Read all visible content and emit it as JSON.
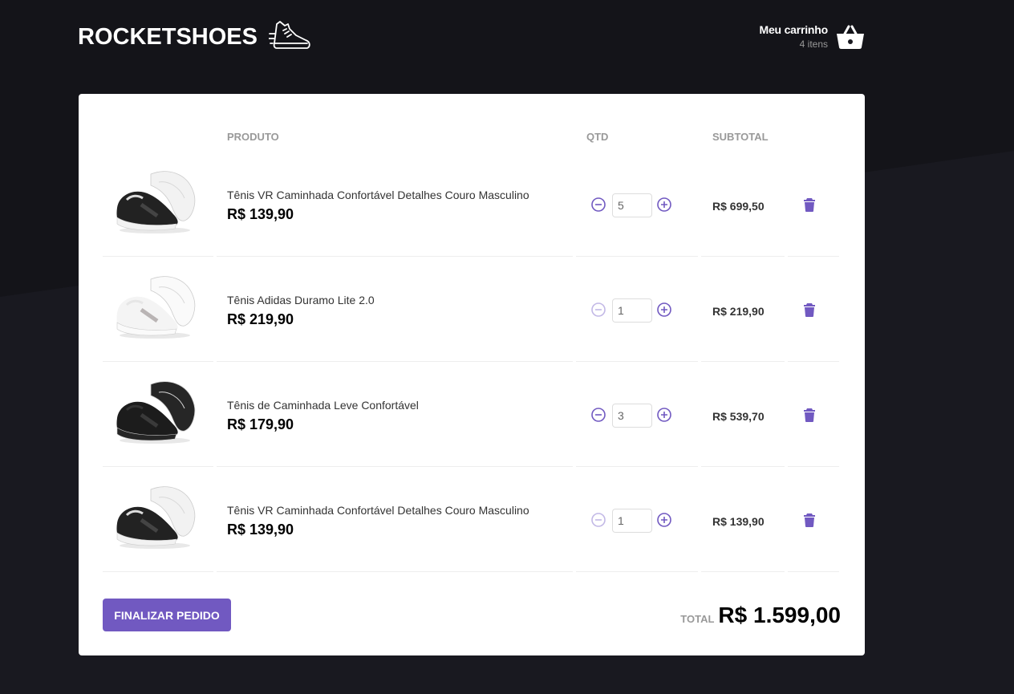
{
  "header": {
    "logo_text": "ROCKETSHOES",
    "cart_title": "Meu carrinho",
    "cart_count": "4 itens"
  },
  "table": {
    "headers": {
      "product": "PRODUTO",
      "qty": "QTD",
      "subtotal": "SUBTOTAL"
    },
    "rows": [
      {
        "title": "Tênis VR Caminhada Confortável Detalhes Couro Masculino",
        "price": "R$ 139,90",
        "qty": "5",
        "subtotal": "R$ 699,50",
        "shoe": "black-white-sole",
        "decrement_enabled": true
      },
      {
        "title": "Tênis Adidas Duramo Lite 2.0",
        "price": "R$ 219,90",
        "qty": "1",
        "subtotal": "R$ 219,90",
        "shoe": "white",
        "decrement_enabled": false
      },
      {
        "title": "Tênis de Caminhada Leve Confortável",
        "price": "R$ 179,90",
        "qty": "3",
        "subtotal": "R$ 539,70",
        "shoe": "all-black",
        "decrement_enabled": true
      },
      {
        "title": "Tênis VR Caminhada Confortável Detalhes Couro Masculino",
        "price": "R$ 139,90",
        "qty": "1",
        "subtotal": "R$ 139,90",
        "shoe": "black-white-sole",
        "decrement_enabled": false
      }
    ]
  },
  "footer": {
    "checkout_label": "Finalizar pedido",
    "total_label": "TOTAL",
    "total_value": "R$ 1.599,00"
  },
  "colors": {
    "accent": "#7159c1",
    "accent_disabled": "#c2b8e6",
    "background": "#191920"
  }
}
